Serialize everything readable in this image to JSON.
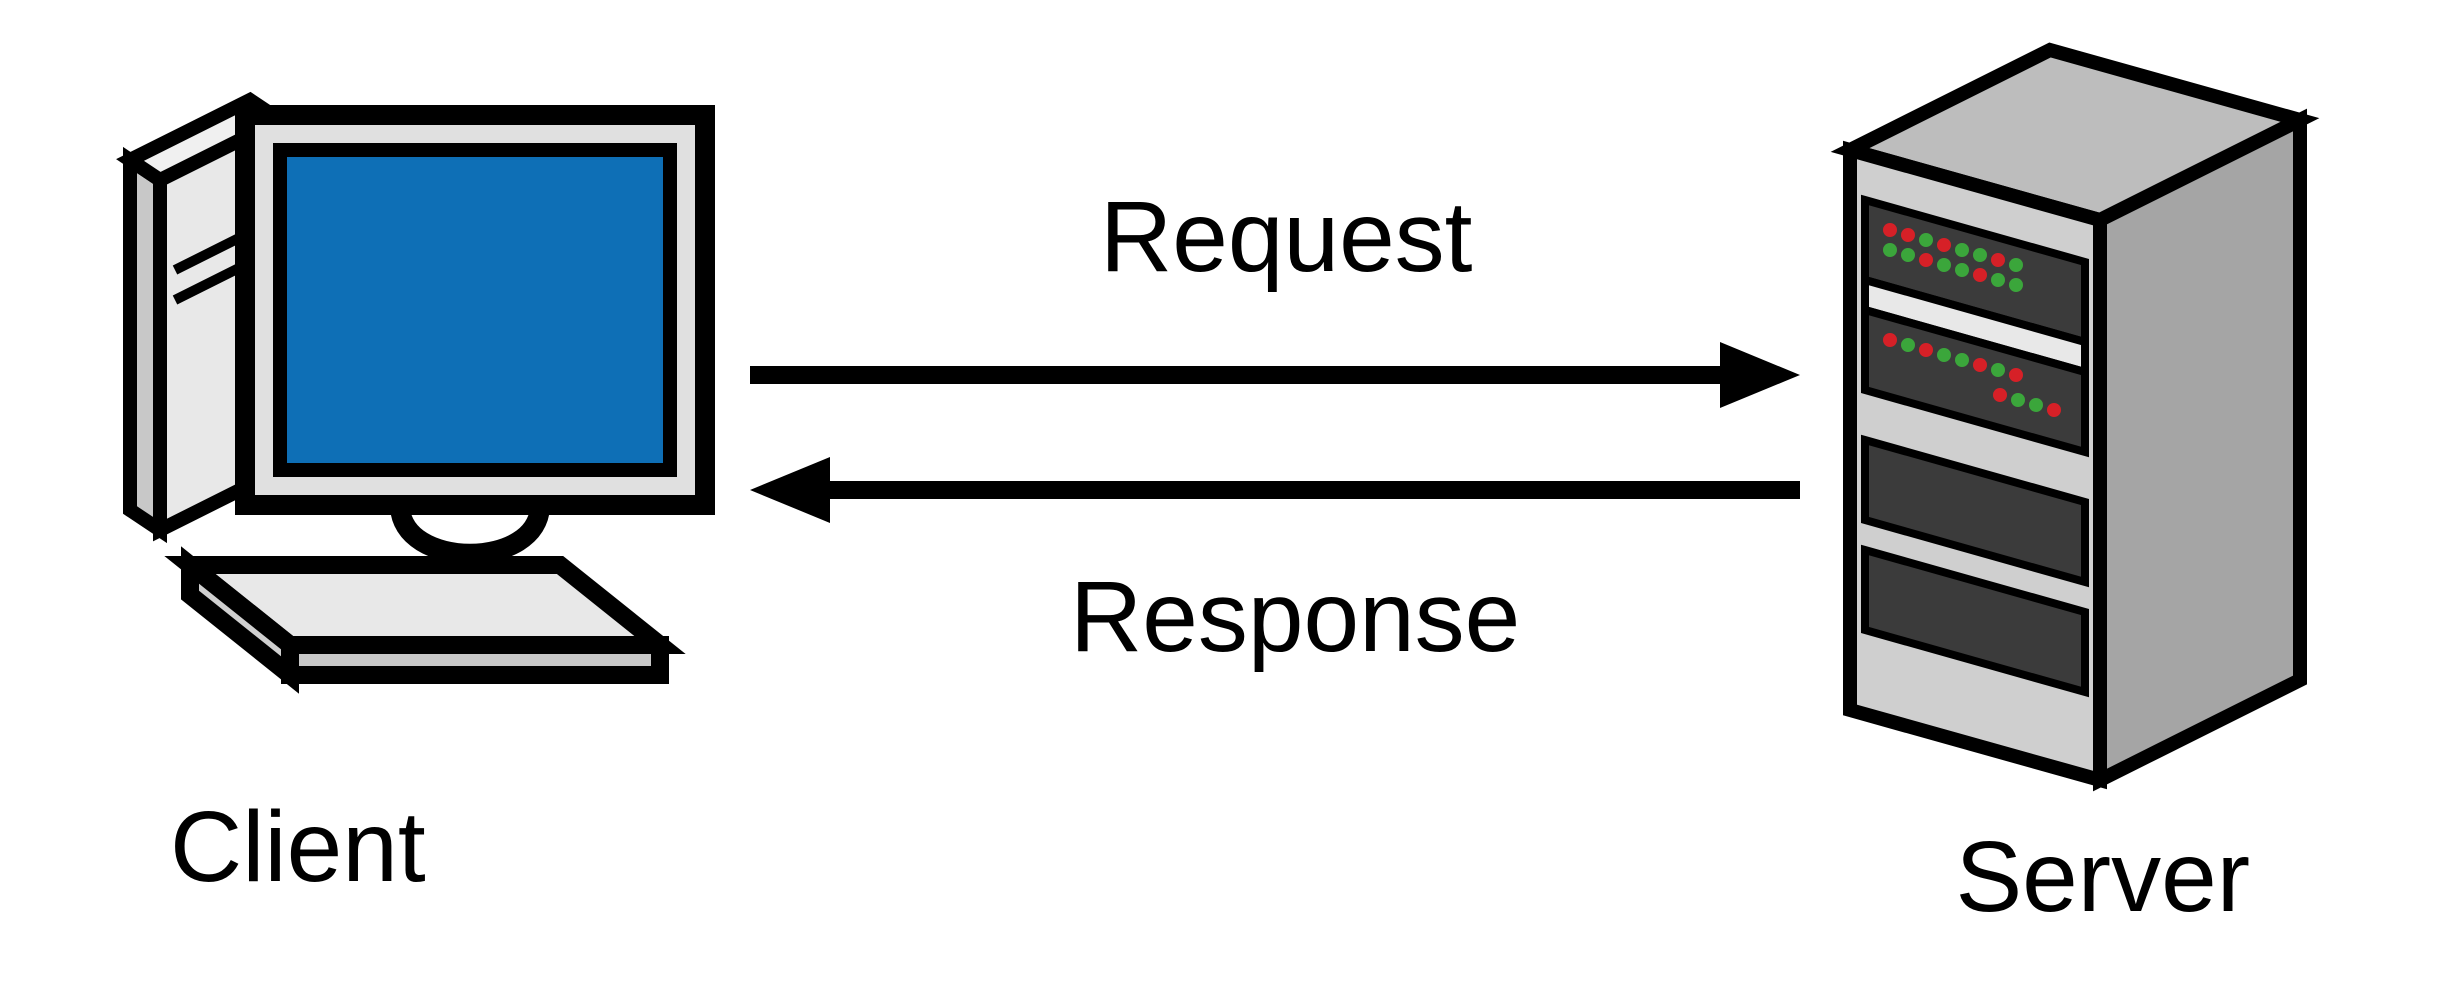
{
  "labels": {
    "client": "Client",
    "server": "Server",
    "request": "Request",
    "response": "Response"
  },
  "colors": {
    "screen": "#0E6FB6",
    "serverBody": "#B1B1B1",
    "serverDark": "#3B3B3B",
    "ledRed": "#D62027",
    "ledGreen": "#3BA63B"
  }
}
